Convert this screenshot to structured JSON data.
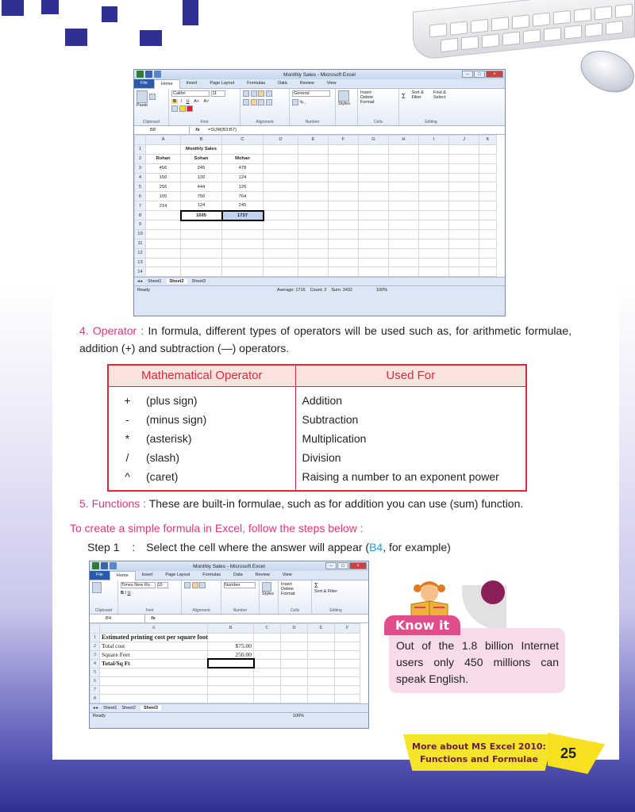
{
  "excel1": {
    "title": "Monthly Sales - Microsoft Excel",
    "tabs": [
      "File",
      "Home",
      "Insert",
      "Page Layout",
      "Formulas",
      "Data",
      "Review",
      "View"
    ],
    "font_name": "Calibri",
    "font_size": "11",
    "number_format": "General",
    "groups": [
      "Clipboard",
      "Font",
      "Alignment",
      "Number",
      "Cells",
      "Editing"
    ],
    "cells_buttons": [
      "Insert",
      "Delete",
      "Format"
    ],
    "editing_buttons": [
      "Sort & Filter",
      "Find & Select"
    ],
    "paste_label": "Paste",
    "styles_label": "Styles",
    "name_box": "B8",
    "formula": "=SUM(B3:B7)",
    "columns": [
      "",
      "A",
      "B",
      "C",
      "D",
      "E",
      "F",
      "G",
      "H",
      "I",
      "J",
      "K"
    ],
    "rows": [
      [
        "1",
        "",
        "Monthly Sales",
        "",
        "",
        "",
        "",
        "",
        "",
        "",
        "",
        ""
      ],
      [
        "2",
        "Rohan",
        "Sohan",
        "Mohan",
        "",
        "",
        "",
        "",
        "",
        "",
        "",
        ""
      ],
      [
        "3",
        "456",
        "245",
        "478",
        "",
        "",
        "",
        "",
        "",
        "",
        "",
        ""
      ],
      [
        "4",
        "156",
        "126",
        "124",
        "",
        "",
        "",
        "",
        "",
        "",
        "",
        ""
      ],
      [
        "5",
        "256",
        "444",
        "126",
        "",
        "",
        "",
        "",
        "",
        "",
        "",
        ""
      ],
      [
        "6",
        "105",
        "756",
        "764",
        "",
        "",
        "",
        "",
        "",
        "",
        "",
        ""
      ],
      [
        "7",
        "214",
        "124",
        "245",
        "",
        "",
        "",
        "",
        "",
        "",
        "",
        ""
      ],
      [
        "8",
        "",
        "1695",
        "1737",
        "",
        "",
        "",
        "",
        "",
        "",
        "",
        ""
      ],
      [
        "9",
        "",
        "",
        "",
        "",
        "",
        "",
        "",
        "",
        "",
        "",
        ""
      ],
      [
        "10",
        "",
        "",
        "",
        "",
        "",
        "",
        "",
        "",
        "",
        "",
        ""
      ],
      [
        "11",
        "",
        "",
        "",
        "",
        "",
        "",
        "",
        "",
        "",
        "",
        ""
      ],
      [
        "12",
        "",
        "",
        "",
        "",
        "",
        "",
        "",
        "",
        "",
        "",
        ""
      ],
      [
        "13",
        "",
        "",
        "",
        "",
        "",
        "",
        "",
        "",
        "",
        "",
        ""
      ],
      [
        "14",
        "",
        "",
        "",
        "",
        "",
        "",
        "",
        "",
        "",
        "",
        ""
      ]
    ],
    "sheets": [
      "Sheet1",
      "Sheet2",
      "Sheet3"
    ],
    "status_ready": "Ready",
    "status_average": "Average: 1716",
    "status_count": "Count: 2",
    "status_sum": "Sum: 3432",
    "zoom": "100%"
  },
  "operator_item": {
    "number": "4.",
    "title": "Operator :",
    "text": " In formula, different types of operators will be used such as, for arithmetic formulae, addition (+) and subtraction (—) operators."
  },
  "operators_table": {
    "headers": [
      "Mathematical Operator",
      "Used For"
    ],
    "rows": [
      {
        "symbol": "+",
        "name": "(plus sign)",
        "use": "Addition"
      },
      {
        "symbol": "-",
        "name": "(minus sign)",
        "use": "Subtraction"
      },
      {
        "symbol": "*",
        "name": "(asterisk)",
        "use": "Multiplication"
      },
      {
        "symbol": "/",
        "name": "(slash)",
        "use": "Division"
      },
      {
        "symbol": "^",
        "name": "(caret)",
        "use": "Raising a number to an exponent power"
      }
    ]
  },
  "functions_item": {
    "number": "5.",
    "title": "Functions :",
    "text": " These are built-in formulae, such as for addition you can use (sum) function."
  },
  "steps_heading": "To create a simple formula in Excel, follow the steps below :",
  "step1": {
    "label": "Step 1",
    "colon": ":",
    "text_before": "Select the cell where the answer will appear (",
    "cell_ref": "B4",
    "text_after": ", for example)"
  },
  "excel2": {
    "title": "Monthly Sales - Microsoft Excel",
    "tabs": [
      "File",
      "Home",
      "Insert",
      "Page Layout",
      "Formulas",
      "Data",
      "Review",
      "View"
    ],
    "font_name": "Times New Ro",
    "font_size": "15",
    "number_format": "Number",
    "name_box": "B4",
    "columns": [
      "",
      "A",
      "B",
      "C",
      "D",
      "E",
      "F"
    ],
    "rows": [
      [
        "1",
        "Estimated printing cost per square foot",
        "",
        "",
        "",
        "",
        ""
      ],
      [
        "2",
        "Total cost",
        "$75.00",
        "",
        "",
        "",
        ""
      ],
      [
        "3",
        "Square Feet",
        "250.00",
        "",
        "",
        "",
        ""
      ],
      [
        "4",
        "Total/Sq Ft",
        "",
        "",
        "",
        "",
        ""
      ],
      [
        "5",
        "",
        "",
        "",
        "",
        "",
        ""
      ],
      [
        "6",
        "",
        "",
        "",
        "",
        "",
        ""
      ],
      [
        "7",
        "",
        "",
        "",
        "",
        "",
        ""
      ],
      [
        "8",
        "",
        "",
        "",
        "",
        "",
        ""
      ]
    ],
    "sheets": [
      "Sheet1",
      "Sheet2",
      "Sheet3"
    ],
    "status_ready": "Ready",
    "zoom": "100%"
  },
  "know_it": {
    "label": "Know it",
    "text": "Out of the 1.8 billion Internet users only 450 millions can speak English."
  },
  "footer": {
    "line1": "More about MS Excel 2010:",
    "line2": "Functions and Formulae",
    "page": "25"
  },
  "colors": {
    "accent_pink": "#e0357f",
    "table_red": "#e0283b",
    "highlight_blue": "#1aa1d8",
    "brand_navy": "#2e3192",
    "footer_yellow": "#f4e42a"
  }
}
